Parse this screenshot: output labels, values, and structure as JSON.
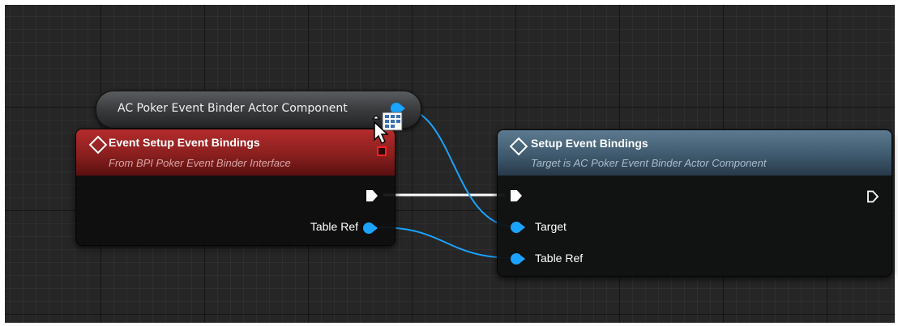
{
  "graph": {
    "background": "#262626"
  },
  "variable_node": {
    "label": "AC Poker Event Binder Actor Component",
    "pin_color": "#1aa3ff"
  },
  "event_node": {
    "title": "Event Setup Event Bindings",
    "subtitle": "From BPI Poker Event Binder Interface",
    "header_color": "#9e2525",
    "icon": "event-diamond-icon",
    "delegate_icon": "delegate-pin-icon",
    "pins": {
      "table_ref_label": "Table Ref"
    }
  },
  "function_node": {
    "title": "Setup Event Bindings",
    "subtitle": "Target is AC Poker Event Binder Actor Component",
    "header_color": "#4a667c",
    "icon": "function-diamond-icon",
    "pins": {
      "target_label": "Target",
      "table_ref_label": "Table Ref"
    }
  },
  "wires": {
    "exec_color": "#ffffff",
    "object_color": "#1aa3ff"
  },
  "cursor": {
    "icon": "drag-drop-cursor-icon"
  }
}
